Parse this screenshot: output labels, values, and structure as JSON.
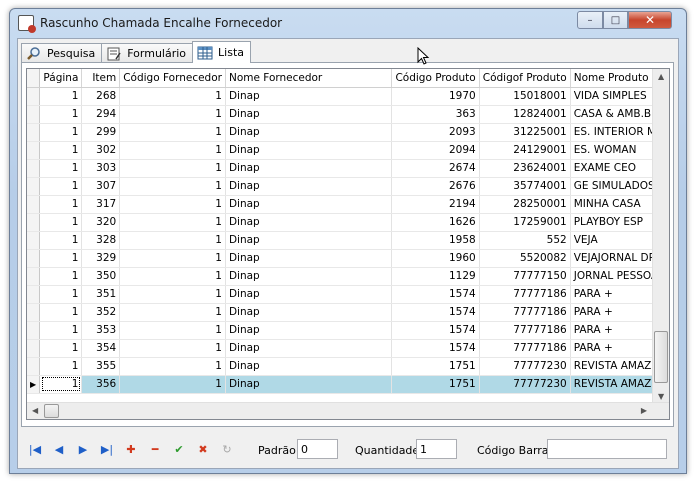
{
  "window": {
    "title": "Rascunho Chamada Encalhe Fornecedor"
  },
  "controls": {
    "minimize": "–",
    "maximize": "□",
    "close": "✕"
  },
  "tabs": [
    {
      "label": "Pesquisa",
      "icon": "magnifier-icon"
    },
    {
      "label": "Formulário",
      "icon": "form-icon"
    },
    {
      "label": "Lista",
      "icon": "grid-icon"
    }
  ],
  "grid": {
    "headers": [
      "Página",
      "Item",
      "Código Fornecedor",
      "Nome Fornecedor",
      "Código Produto",
      "Códigof Produto",
      "Nome Produto"
    ],
    "rows": [
      [
        "1",
        "268",
        "1",
        "Dinap",
        "1970",
        "15018001",
        "VIDA SIMPLES"
      ],
      [
        "1",
        "294",
        "1",
        "Dinap",
        "363",
        "12824001",
        "CASA & AMB.BEB"
      ],
      [
        "1",
        "299",
        "1",
        "Dinap",
        "2093",
        "31225001",
        "ES. INTERIOR MI"
      ],
      [
        "1",
        "302",
        "1",
        "Dinap",
        "2094",
        "24129001",
        "ES. WOMAN"
      ],
      [
        "1",
        "303",
        "1",
        "Dinap",
        "2674",
        "23624001",
        "EXAME CEO"
      ],
      [
        "1",
        "307",
        "1",
        "Dinap",
        "2676",
        "35774001",
        "GE SIMULADOS"
      ],
      [
        "1",
        "317",
        "1",
        "Dinap",
        "2194",
        "28250001",
        "MINHA CASA"
      ],
      [
        "1",
        "320",
        "1",
        "Dinap",
        "1626",
        "17259001",
        "PLAYBOY  ESP"
      ],
      [
        "1",
        "328",
        "1",
        "Dinap",
        "1958",
        "552",
        "VEJA"
      ],
      [
        "1",
        "329",
        "1",
        "Dinap",
        "1960",
        "5520082",
        "VEJAJORNAL DP"
      ],
      [
        "1",
        "350",
        "1",
        "Dinap",
        "1129",
        "77777150",
        "JORNAL PESSOA"
      ],
      [
        "1",
        "351",
        "1",
        "Dinap",
        "1574",
        "77777186",
        "PARA +"
      ],
      [
        "1",
        "352",
        "1",
        "Dinap",
        "1574",
        "77777186",
        "PARA +"
      ],
      [
        "1",
        "353",
        "1",
        "Dinap",
        "1574",
        "77777186",
        "PARA +"
      ],
      [
        "1",
        "354",
        "1",
        "Dinap",
        "1574",
        "77777186",
        "PARA +"
      ],
      [
        "1",
        "355",
        "1",
        "Dinap",
        "1751",
        "77777230",
        "REVISTA AMAZO"
      ],
      [
        "1",
        "356",
        "1",
        "Dinap",
        "1751",
        "77777230",
        "REVISTA AMAZO"
      ]
    ],
    "selected_row_index": 16
  },
  "toolbar": {
    "nav": [
      "|◀",
      "◀",
      "▶",
      "▶|",
      "✚",
      "━",
      "✔",
      "✖",
      "↻"
    ],
    "padrao_label": "Padrão",
    "padrao_value": "0",
    "quantidade_label": "Quantidade",
    "quantidade_value": "1",
    "codigo_barras_label": "Código Barras",
    "codigo_barras_value": ""
  },
  "colors": {
    "selected_row": "#b0d9e6",
    "nav_blue": "#1f5fc8",
    "nav_red": "#d23a1e",
    "nav_green": "#2e9b2e"
  }
}
